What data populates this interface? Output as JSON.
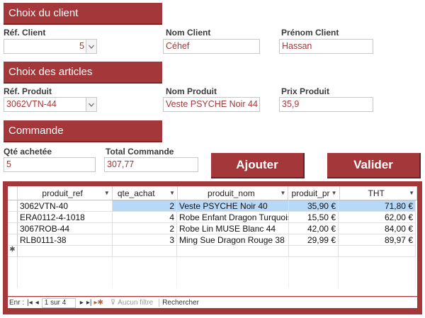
{
  "sections": {
    "client": "Choix du client",
    "articles": "Choix des articles",
    "commande": "Commande"
  },
  "client": {
    "ref_label": "Réf. Client",
    "ref_value": "5",
    "nom_label": "Nom Client",
    "nom_value": "Céhef",
    "prenom_label": "Prénom Client",
    "prenom_value": "Hassan"
  },
  "produit": {
    "ref_label": "Réf. Produit",
    "ref_value": "3062VTN-44",
    "nom_label": "Nom Produit",
    "nom_value": "Veste PSYCHE Noir 44",
    "prix_label": "Prix Produit",
    "prix_value": "35,9"
  },
  "commande": {
    "qte_label": "Qté achetée",
    "qte_value": "5",
    "total_label": "Total Commande",
    "total_value": "307,77"
  },
  "buttons": {
    "ajouter": "Ajouter",
    "valider": "Valider"
  },
  "table": {
    "columns": [
      "produit_ref",
      "qte_achat",
      "produit_nom",
      "produit_pr",
      "THT"
    ],
    "rows": [
      {
        "ref": "3062VTN-40",
        "qte": "2",
        "nom": "Veste PSYCHE Noir 40",
        "prix": "35,90 €",
        "tht": "71,80 €"
      },
      {
        "ref": "ERA0112-4-1018",
        "qte": "4",
        "nom": "Robe Enfant Dragon Turquoise",
        "prix": "15,50 €",
        "tht": "62,00 €"
      },
      {
        "ref": "3067ROB-44",
        "qte": "2",
        "nom": "Robe Lin MUSE Blanc 44",
        "prix": "42,00 €",
        "tht": "84,00 €"
      },
      {
        "ref": "RLB0111-38",
        "qte": "3",
        "nom": "Ming Sue Dragon Rouge 38",
        "prix": "29,99 €",
        "tht": "89,97 €"
      }
    ],
    "new_row_marker": "✱"
  },
  "nav": {
    "label": "Enr :",
    "position": "1 sur 4",
    "filter": "Aucun filtre",
    "search": "Rechercher"
  },
  "colors": {
    "accent": "#a4373a",
    "selected_row": "#b7d8f7"
  }
}
